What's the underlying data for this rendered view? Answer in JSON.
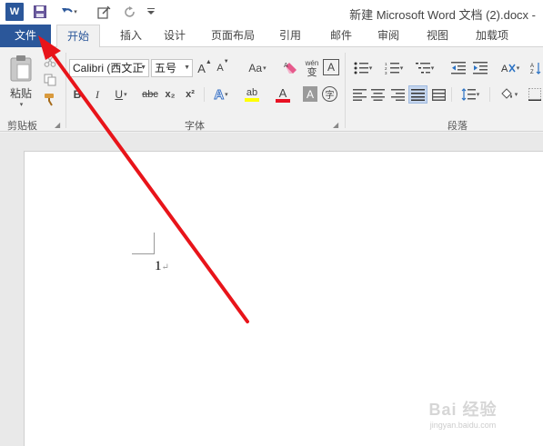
{
  "titlebar": {
    "word_logo": "W",
    "document_title": "新建 Microsoft Word 文档 (2).docx - ",
    "icons": [
      "word-logo",
      "save-icon",
      "undo-icon",
      "touch-mode-icon",
      "redo-icon",
      "customize-toolbar-icon"
    ]
  },
  "tabs": [
    {
      "label": "文件"
    },
    {
      "label": "开始"
    },
    {
      "label": "插入"
    },
    {
      "label": "设计"
    },
    {
      "label": "页面布局"
    },
    {
      "label": "引用"
    },
    {
      "label": "邮件"
    },
    {
      "label": "审阅"
    },
    {
      "label": "视图"
    },
    {
      "label": "加载项"
    }
  ],
  "ribbon": {
    "clipboard": {
      "label": "剪贴板",
      "paste_label": "粘贴"
    },
    "font": {
      "label": "字体",
      "font_name": "Calibri (西文正",
      "font_size": "五号",
      "grow": "A",
      "shrink": "A",
      "change_case": "Aa",
      "phonetic_top": "wén",
      "phonetic_bottom": "变",
      "char_border": "A",
      "bold": "B",
      "italic": "I",
      "underline": "U",
      "strikethrough": "abc",
      "subscript": "x₂",
      "superscript": "x²",
      "text_effects": "A",
      "highlight": "ab",
      "font_color": "A",
      "char_shading": "A",
      "enclose": "字"
    },
    "paragraph": {
      "label": "段落"
    }
  },
  "document": {
    "text": "1",
    "paragraph_mark": "↵"
  },
  "watermark": {
    "main": "Bai 经验",
    "sub": "jingyan.baidu.com"
  },
  "colors": {
    "file_tab": "#2b579a",
    "arrow": "#e8141a",
    "highlight_bar": "#ffff00",
    "font_color_bar": "#e81123"
  }
}
